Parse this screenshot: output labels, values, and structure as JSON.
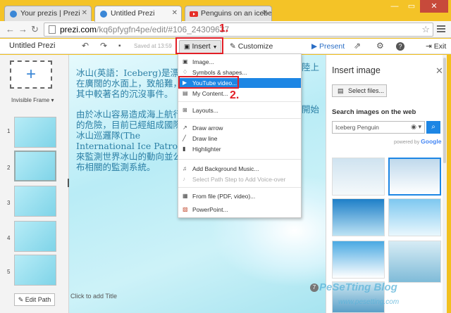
{
  "browser": {
    "tabs": [
      {
        "title": "Your prezis | Prezi",
        "active": false
      },
      {
        "title": "Untitled Prezi",
        "active": true
      },
      {
        "title": "Penguins on an iceberg",
        "active": false
      }
    ],
    "url_host": "prezi.com",
    "url_path": "/kq6pfygfn4pe/edit/#106_24309637"
  },
  "toolbar": {
    "title": "Untitled Prezi",
    "saved": "Saved at 13:59",
    "insert_label": "Insert",
    "customize_label": "Customize",
    "present_label": "Present",
    "exit_label": "Exit"
  },
  "annotations": {
    "step1": "1.",
    "step2": "2."
  },
  "insert_menu": {
    "items": [
      {
        "label": "Image...",
        "icon": "image-icon"
      },
      {
        "label": "Symbols & shapes...",
        "icon": "shapes-icon"
      },
      {
        "label": "YouTube video...",
        "icon": "youtube-icon",
        "highlighted": true
      },
      {
        "label": "My Content...",
        "icon": "folder-icon"
      },
      {
        "label": "Layouts...",
        "icon": "layouts-icon"
      },
      {
        "label": "Draw arrow",
        "icon": "arrow-icon"
      },
      {
        "label": "Draw line",
        "icon": "line-icon"
      },
      {
        "label": "Highlighter",
        "icon": "highlighter-icon"
      },
      {
        "label": "Add Background Music...",
        "icon": "music-icon"
      },
      {
        "label": "Select Path Step to Add Voice-over",
        "icon": "voice-icon",
        "disabled": true
      },
      {
        "label": "From file (PDF, video)...",
        "icon": "file-icon"
      },
      {
        "label": "PowerPoint...",
        "icon": "powerpoint-icon"
      }
    ]
  },
  "left_panel": {
    "invisible_frame": "Invisible Frame",
    "thumb_numbers": [
      "1",
      "2",
      "3",
      "4",
      "5"
    ],
    "edit_path": "Edit Path"
  },
  "canvas": {
    "text_block_1": "冰山(英語：Iceberg)是漂浮在廣闊的水面上，致船難，其中較著名的沉沒事件。",
    "text_block_2": "由於冰山容易造成海上航行的危險，目前已經組成國際冰山巡邏隊(The International Ice Patrol)來監測世界冰山的動向並公布相關的監測系統。",
    "fragment": "陸上",
    "fragment2": "開始",
    "click_title": "Click to add Title"
  },
  "insert_image": {
    "title": "Insert image",
    "select_files": "Select files...",
    "search_label": "Search images on the web",
    "search_value": "Iceberg Penguin",
    "powered_by": "powered by",
    "google": "Google"
  },
  "footer": {
    "badge": "7",
    "watermark": "PeSeTting Blog",
    "watermark_url": "www.pesetting.com"
  }
}
